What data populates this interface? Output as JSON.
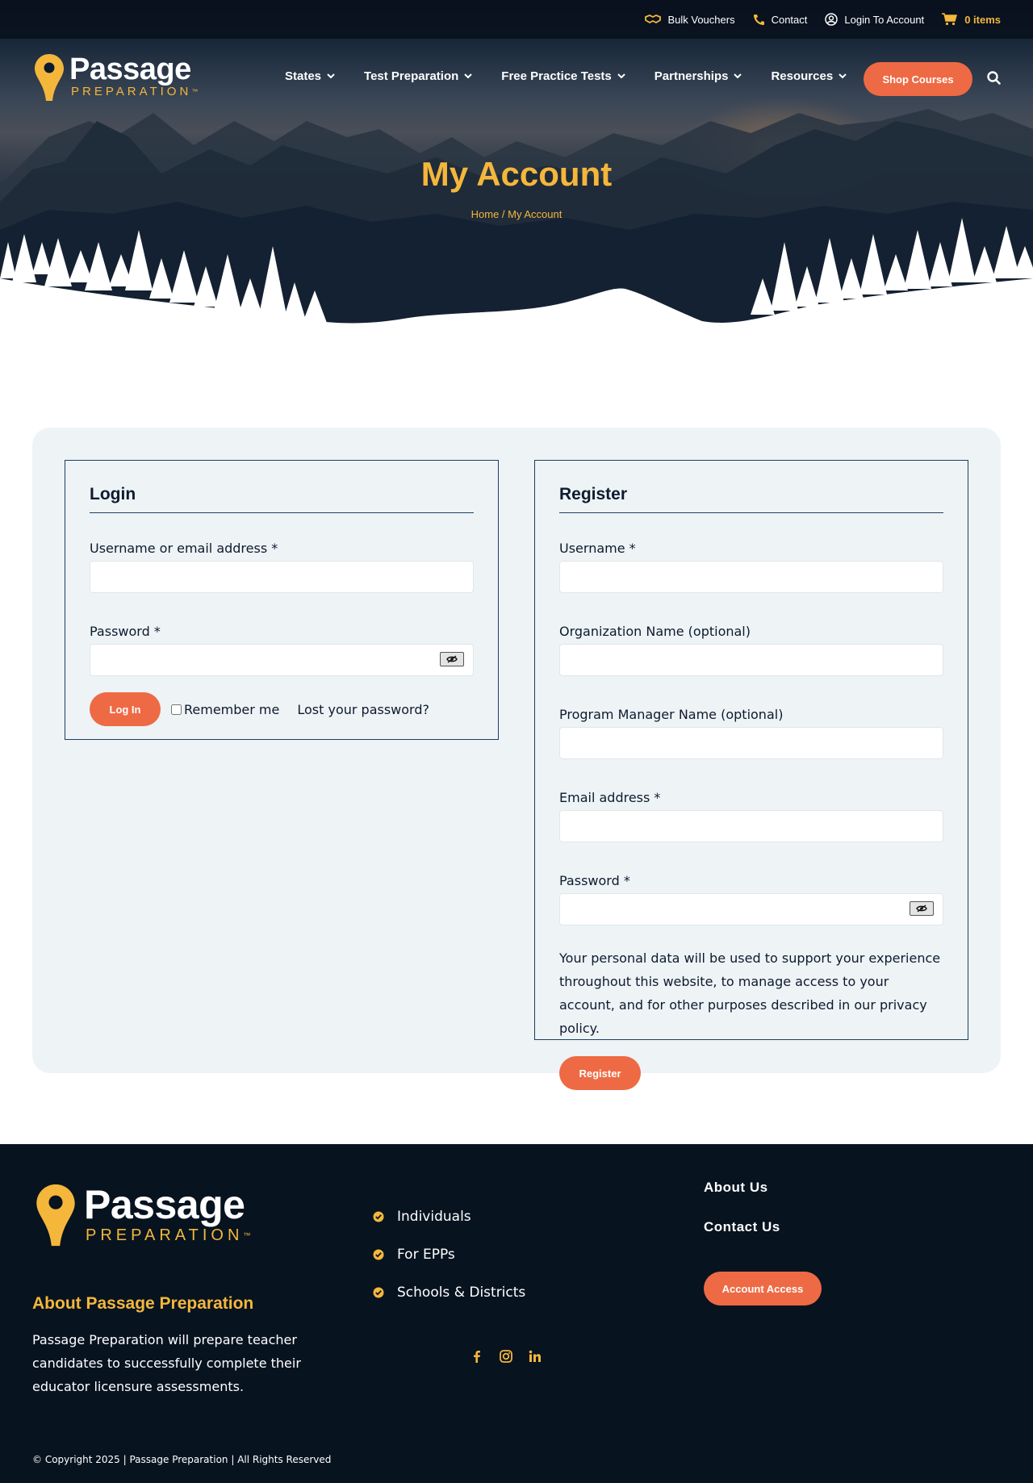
{
  "topbar": {
    "vouchers": "Bulk Vouchers",
    "contact": "Contact",
    "login": "Login To Account",
    "cart": "0 items"
  },
  "brand": {
    "name": "Passage",
    "tagline": "PREPARATION",
    "tm": "™"
  },
  "nav": {
    "items": [
      "States",
      "Test Preparation",
      "Free Practice Tests",
      "Partnerships",
      "Resources"
    ],
    "shop_label": "Shop Courses"
  },
  "hero": {
    "title": "My Account",
    "breadcrumb_home": "Home",
    "breadcrumb_sep": " / ",
    "breadcrumb_current": "My Account"
  },
  "login": {
    "title": "Login",
    "username_label": "Username or email address *",
    "password_label": "Password *",
    "submit_label": "Log In",
    "remember_label": "Remember me",
    "lost_label": "Lost your password?"
  },
  "register": {
    "title": "Register",
    "username_label": "Username *",
    "org_label": "Organization Name (optional)",
    "manager_label": "Program Manager Name (optional)",
    "email_label": "Email address *",
    "password_label": "Password *",
    "privacy_text": "Your personal data will be used to support your experience throughout this website, to manage access to your account, and for other purposes described in our ",
    "privacy_link": "privacy policy",
    "privacy_end": ".",
    "submit_label": "Register"
  },
  "footer": {
    "about_title": "About Passage Preparation",
    "about_text": "Passage Preparation will prepare teacher candidates to successfully complete their educator licensure assessments.",
    "list": [
      "Individuals",
      "For EPPs",
      "Schools & Districts"
    ],
    "links": [
      "About Us",
      "Contact Us"
    ],
    "account_label": "Account Access",
    "social": [
      "facebook-icon",
      "instagram-icon",
      "linkedin-icon"
    ],
    "copyright": "© Copyright 2025 | Passage Preparation | All Rights Reserved"
  },
  "colors": {
    "accent_orange": "#ee6a44",
    "accent_gold": "#f4b73b",
    "navy": "#081320",
    "panel_bg": "#eef3f6"
  }
}
